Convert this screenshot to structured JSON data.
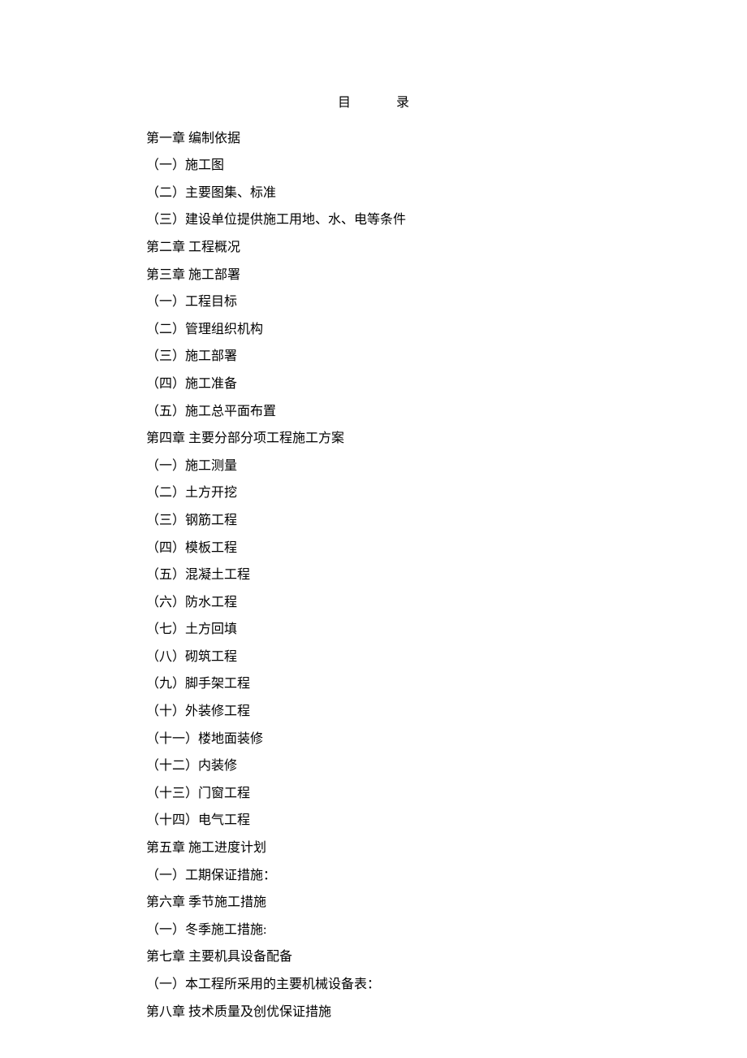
{
  "title": "目录",
  "toc": [
    {
      "level": 1,
      "text": "第一章 编制依据"
    },
    {
      "level": 2,
      "text": "（一）施工图"
    },
    {
      "level": 2,
      "text": "（二）主要图集、标准"
    },
    {
      "level": 2,
      "text": "（三）建设单位提供施工用地、水、电等条件"
    },
    {
      "level": 1,
      "text": "第二章 工程概况"
    },
    {
      "level": 1,
      "text": "第三章 施工部署"
    },
    {
      "level": 2,
      "text": "（一）工程目标"
    },
    {
      "level": 2,
      "text": "（二）管理组织机构"
    },
    {
      "level": 2,
      "text": "（三）施工部署"
    },
    {
      "level": 2,
      "text": "（四）施工准备"
    },
    {
      "level": 2,
      "text": "（五）施工总平面布置"
    },
    {
      "level": 1,
      "text": "第四章 主要分部分项工程施工方案"
    },
    {
      "level": 2,
      "text": "（一）施工测量"
    },
    {
      "level": 2,
      "text": "（二）土方开挖"
    },
    {
      "level": 2,
      "text": "（三）钢筋工程"
    },
    {
      "level": 2,
      "text": "（四）模板工程"
    },
    {
      "level": 2,
      "text": "（五）混凝土工程"
    },
    {
      "level": 2,
      "text": "（六）防水工程"
    },
    {
      "level": 2,
      "text": "（七）土方回填"
    },
    {
      "level": 2,
      "text": "（八）砌筑工程"
    },
    {
      "level": 2,
      "text": "（九）脚手架工程"
    },
    {
      "level": 2,
      "text": "（十）外装修工程"
    },
    {
      "level": 2,
      "text": "（十一）楼地面装修"
    },
    {
      "level": 2,
      "text": "（十二）内装修"
    },
    {
      "level": 2,
      "text": "（十三）门窗工程"
    },
    {
      "level": 2,
      "text": "（十四）电气工程"
    },
    {
      "level": 1,
      "text": "第五章 施工进度计划"
    },
    {
      "level": 2,
      "text": "（一）工期保证措施："
    },
    {
      "level": 1,
      "text": "第六章 季节施工措施"
    },
    {
      "level": 2,
      "text": "（一）冬季施工措施:"
    },
    {
      "level": 1,
      "text": "第七章 主要机具设备配备"
    },
    {
      "level": 2,
      "text": "（一）本工程所采用的主要机械设备表："
    },
    {
      "level": 1,
      "text": "第八章 技术质量及创优保证措施"
    }
  ]
}
